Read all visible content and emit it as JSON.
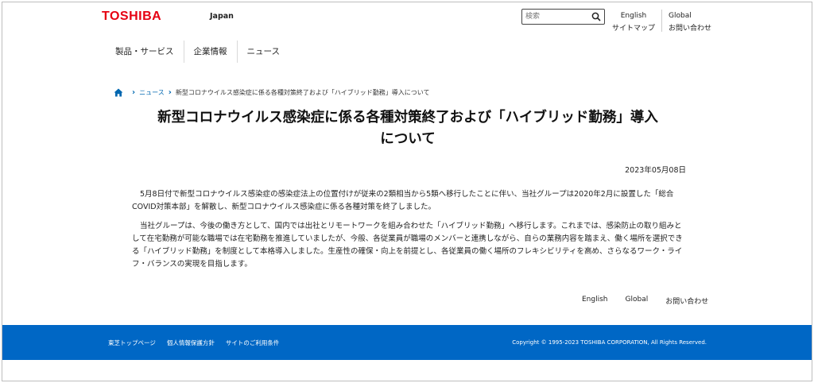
{
  "header": {
    "logo": "TOSHIBA",
    "region": "Japan",
    "search_placeholder": "検索",
    "links_col1": [
      "English",
      "サイトマップ"
    ],
    "links_col2": [
      "Global",
      "お問い合わせ"
    ]
  },
  "global_nav": {
    "items": [
      "製品・サービス",
      "企業情報",
      "ニュース"
    ]
  },
  "breadcrumb": {
    "items": [
      "ニュース",
      "新型コロナウイルス感染症に係る各種対策終了および「ハイブリッド勤務」導入について"
    ]
  },
  "article": {
    "title_line1": "新型コロナウイルス感染症に係る各種対策終了および「ハイブリッド勤務」導入",
    "title_line2": "について",
    "date": "2023年05月08日",
    "paragraphs": [
      "5月8日付で新型コロナウイルス感染症の感染症法上の位置付けが従来の2類相当から5類へ移行したことに伴い、当社グループは2020年2月に設置した「総合COVID対策本部」を解散し、新型コロナウイルス感染症に係る各種対策を終了しました。",
      "当社グループは、今後の働き方として、国内では出社とリモートワークを組み合わせた「ハイブリッド勤務」へ移行します。これまでは、感染防止の取り組みとして在宅勤務が可能な職場では在宅勤務を推進していましたが、今般、各従業員が職場のメンバーと連携しながら、自らの業務内容を踏まえ、働く場所を選択できる「ハイブリッド勤務」を制度として本格導入しました。生産性の確保・向上を前提とし、各従業員の働く場所のフレキシビリティを高め、さらなるワーク・ライフ・バランスの実現を目指します。"
    ]
  },
  "bottom_links": [
    "English",
    "Global",
    "お問い合わせ"
  ],
  "footer": {
    "links": [
      "東芝トップページ",
      "個人情報保護方針",
      "サイトのご利用条件"
    ],
    "copyright": "Copyright © 1995-2023 TOSHIBA CORPORATION, All Rights Reserved."
  },
  "colors": {
    "brand_red": "#e60012",
    "accent_blue": "#0067b0",
    "footer_blue": "#0067c5"
  }
}
